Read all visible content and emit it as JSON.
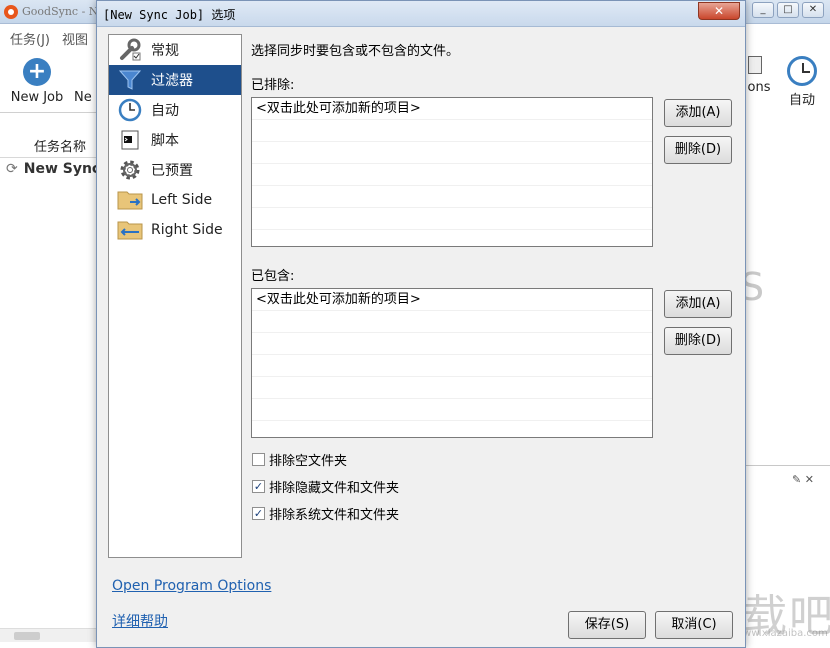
{
  "background_window": {
    "title": "GoodSync - N",
    "menu": [
      "任务(J)",
      "视图"
    ],
    "toolbar": {
      "new_job": "New Job",
      "second_partial": "Ne",
      "options_partial": "ons",
      "auto": "自动"
    },
    "task_name_header": "任务名称",
    "job_item": "New Sync",
    "window_buttons": [
      "_",
      "□",
      "✕"
    ],
    "partial_letter": "S"
  },
  "dialog": {
    "title": "[New Sync Job] 选项",
    "close": "✕",
    "nav": [
      {
        "label": "常规",
        "icon": "wrench-icon"
      },
      {
        "label": "过滤器",
        "icon": "filter-icon",
        "selected": true
      },
      {
        "label": "自动",
        "icon": "clock-icon"
      },
      {
        "label": "脚本",
        "icon": "script-icon"
      },
      {
        "label": "已预置",
        "icon": "gear-icon"
      },
      {
        "label": "Left Side",
        "icon": "folder-left-icon"
      },
      {
        "label": "Right Side",
        "icon": "folder-right-icon"
      }
    ],
    "filter": {
      "intro": "选择同步时要包含或不包含的文件。",
      "excluded_label": "已排除:",
      "excluded_items": [
        "<双击此处可添加新的项目>"
      ],
      "included_label": "已包含:",
      "included_items": [
        "<双击此处可添加新的项目>"
      ],
      "add_button": "添加(A)",
      "delete_button": "删除(D)",
      "checkboxes": [
        {
          "label": "排除空文件夹",
          "checked": false
        },
        {
          "label": "排除隐藏文件和文件夹",
          "checked": true
        },
        {
          "label": "排除系统文件和文件夹",
          "checked": true
        }
      ]
    },
    "footer": {
      "open_program_options": "Open Program Options",
      "help": "详细帮助",
      "save": "保存(S)",
      "cancel": "取消(C)"
    }
  },
  "watermark": "下载吧",
  "watermark_url": "www.xiazaiba.com",
  "colors": {
    "selected_nav": "#1e4f8c",
    "link": "#2061b0",
    "accent_blue": "#3a7fc1"
  }
}
